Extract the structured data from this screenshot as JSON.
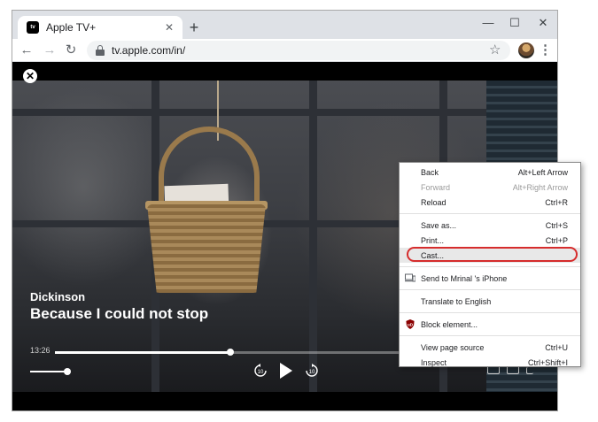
{
  "browser": {
    "tab": {
      "favicon_text": "tv",
      "title": "Apple TV+",
      "close_glyph": "✕"
    },
    "new_tab_glyph": "+",
    "window_controls": {
      "minimize": "—",
      "maximize": "☐",
      "close": "✕"
    },
    "nav": {
      "back_glyph": "←",
      "forward_glyph": "→",
      "reload_glyph": "↻"
    },
    "url": "tv.apple.com/in/",
    "star_glyph": "☆",
    "menu_glyph": "⋮"
  },
  "player": {
    "close_glyph": "✕",
    "show_title": "Dickinson",
    "episode_title": "Because I could not stop",
    "current_time": "13:26",
    "progress_fraction": 0.38,
    "volume_fraction": 0.95,
    "skip_back_label": "10",
    "skip_forward_label": "10"
  },
  "context_menu": {
    "group1": [
      {
        "label": "Back",
        "shortcut": "Alt+Left Arrow",
        "disabled": false
      },
      {
        "label": "Forward",
        "shortcut": "Alt+Right Arrow",
        "disabled": true
      },
      {
        "label": "Reload",
        "shortcut": "Ctrl+R",
        "disabled": false
      }
    ],
    "group2": [
      {
        "label": "Save as...",
        "shortcut": "Ctrl+S"
      },
      {
        "label": "Print...",
        "shortcut": "Ctrl+P"
      },
      {
        "label": "Cast..."
      }
    ],
    "group3": [
      {
        "label": "Send to Mrinal 's iPhone",
        "icon": "devices-icon"
      }
    ],
    "group4": [
      {
        "label": "Translate to English"
      }
    ],
    "group5": [
      {
        "label": "Block element...",
        "icon": "ublock-shield-icon",
        "icon_text": "uD"
      }
    ],
    "group6": [
      {
        "label": "View page source",
        "shortcut": "Ctrl+U"
      },
      {
        "label": "Inspect",
        "shortcut": "Ctrl+Shift+I"
      }
    ]
  },
  "colors": {
    "highlight_outline": "#d62d2d",
    "ublock_red": "#8b0000"
  }
}
